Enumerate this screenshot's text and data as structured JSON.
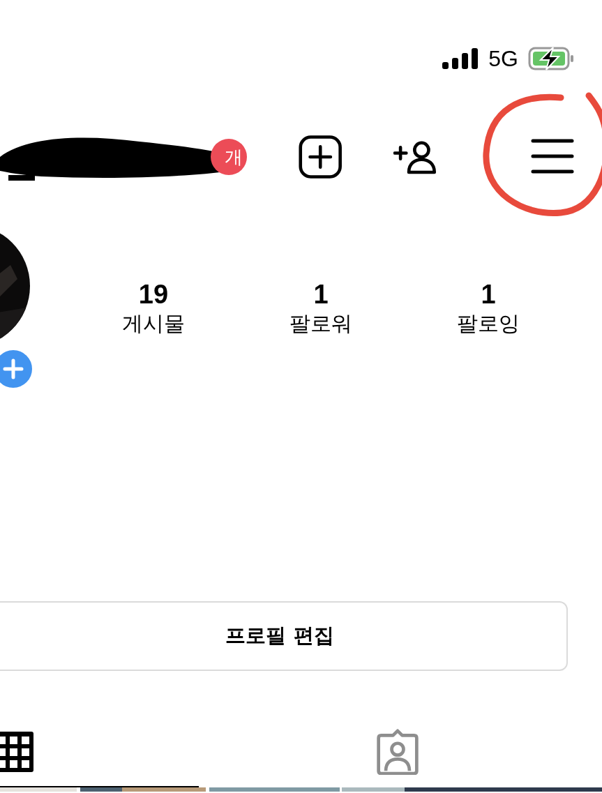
{
  "status_bar": {
    "network": "5G"
  },
  "header": {
    "badge": "개"
  },
  "stats": [
    {
      "value": "19",
      "label": "게시물"
    },
    {
      "value": "1",
      "label": "팔로워"
    },
    {
      "value": "1",
      "label": "팔로잉"
    }
  ],
  "edit_button": "프로필 편집",
  "tabs": [
    {
      "kind": "grid",
      "selected": true
    },
    {
      "kind": "tagged",
      "selected": false
    }
  ]
}
